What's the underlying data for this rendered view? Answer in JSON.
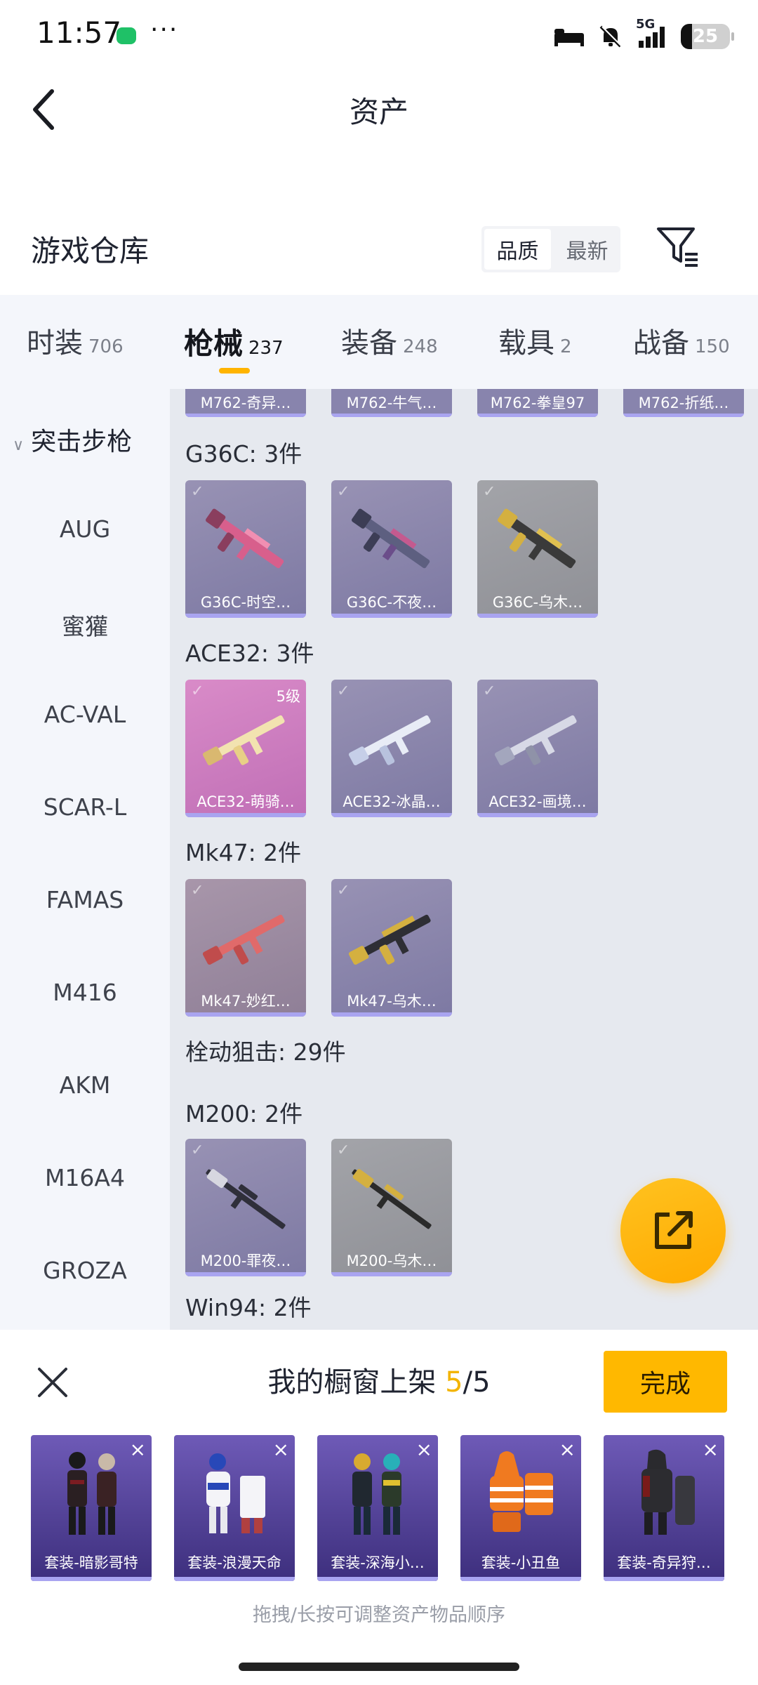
{
  "status": {
    "time": "11:57",
    "more": "···",
    "network": "5G",
    "battery": "25"
  },
  "header": {
    "title": "资产"
  },
  "warehouse": {
    "title": "游戏仓库",
    "sort": [
      "品质",
      "最新"
    ]
  },
  "tabs": [
    {
      "label": "时装",
      "count": "706"
    },
    {
      "label": "枪械",
      "count": "237"
    },
    {
      "label": "装备",
      "count": "248"
    },
    {
      "label": "载具",
      "count": "2"
    },
    {
      "label": "战备",
      "count": "150"
    }
  ],
  "sidebar": {
    "category": "突击步枪",
    "items": [
      "AUG",
      "蜜獾",
      "AC-VAL",
      "SCAR-L",
      "FAMAS",
      "M416",
      "AKM",
      "M16A4",
      "GROZA"
    ]
  },
  "content": {
    "top_row": [
      "M762-奇异…",
      "M762-牛气…",
      "M762-拳皇97",
      "M762-折纸…"
    ],
    "groups": [
      {
        "title": "G36C: 3件",
        "items": [
          "G36C-时空…",
          "G36C-不夜…",
          "G36C-乌木…"
        ]
      },
      {
        "title": "ACE32: 3件",
        "items": [
          "ACE32-萌骑…",
          "ACE32-冰晶…",
          "ACE32-画境…"
        ],
        "level": "5级"
      },
      {
        "title": "Mk47: 2件",
        "items": [
          "Mk47-妙红…",
          "Mk47-乌木…"
        ]
      },
      {
        "title": "栓动狙击: 29件"
      },
      {
        "title": "M200: 2件",
        "items": [
          "M200-罪夜…",
          "M200-乌木…"
        ]
      },
      {
        "title": "Win94: 2件"
      }
    ]
  },
  "showcase": {
    "title_prefix": "我的橱窗上架 ",
    "current": "5",
    "total": "/5",
    "done": "完成",
    "items": [
      "套装-暗影哥特",
      "套装-浪漫天命",
      "套装-深海小…",
      "套装-小丑鱼",
      "套装-奇异狩…"
    ],
    "remove": "×",
    "hint": "拖拽/长按可调整资产物品顺序"
  },
  "colors": {
    "accent": "#ffb800",
    "tab_bg": "#f4f6fb",
    "card_purple": "#8884ad"
  }
}
